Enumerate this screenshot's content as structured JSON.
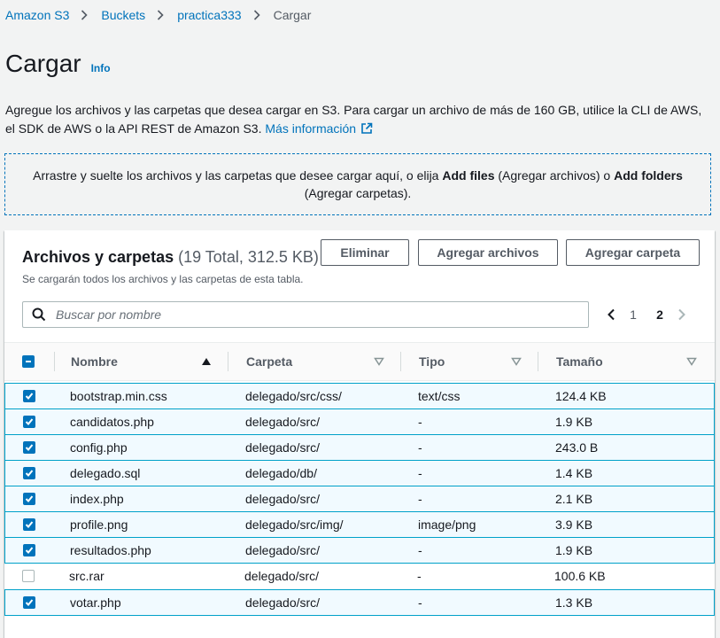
{
  "breadcrumb": [
    {
      "label": "Amazon S3",
      "link": true
    },
    {
      "label": "Buckets",
      "link": true
    },
    {
      "label": "practica333",
      "link": true
    },
    {
      "label": "Cargar",
      "link": false
    }
  ],
  "page": {
    "title": "Cargar",
    "info_label": "Info",
    "description": "Agregue los archivos y las carpetas que desea cargar en S3. Para cargar un archivo de más de 160 GB, utilice la CLI de AWS, el SDK de AWS o la API REST de Amazon S3.",
    "learn_more": "Más información"
  },
  "dropzone": {
    "text_1": "Arrastre y suelte los archivos y las carpetas que desee cargar aquí, o elija",
    "add_files_bold": "Add files",
    "text_2": "(Agregar archivos) o",
    "add_folders_bold": "Add folders",
    "text_3": "(Agregar carpetas)."
  },
  "panel": {
    "title": "Archivos y carpetas",
    "count": "(19 Total, 312.5 KB)",
    "subtitle": "Se cargarán todos los archivos y las carpetas de esta tabla.",
    "delete_label": "Eliminar",
    "add_files_label": "Agregar archivos",
    "add_folder_label": "Agregar carpeta",
    "search_placeholder": "Buscar por nombre",
    "pages": [
      "1",
      "2"
    ],
    "current_page": "2"
  },
  "table": {
    "columns": [
      "Nombre",
      "Carpeta",
      "Tipo",
      "Tamaño"
    ],
    "rows": [
      {
        "name": "bootstrap.min.css",
        "folder": "delegado/src/css/",
        "type": "text/css",
        "size": "124.4 KB",
        "checked": true
      },
      {
        "name": "candidatos.php",
        "folder": "delegado/src/",
        "type": "-",
        "size": "1.9 KB",
        "checked": true
      },
      {
        "name": "config.php",
        "folder": "delegado/src/",
        "type": "-",
        "size": "243.0 B",
        "checked": true
      },
      {
        "name": "delegado.sql",
        "folder": "delegado/db/",
        "type": "-",
        "size": "1.4 KB",
        "checked": true
      },
      {
        "name": "index.php",
        "folder": "delegado/src/",
        "type": "-",
        "size": "2.1 KB",
        "checked": true
      },
      {
        "name": "profile.png",
        "folder": "delegado/src/img/",
        "type": "image/png",
        "size": "3.9 KB",
        "checked": true
      },
      {
        "name": "resultados.php",
        "folder": "delegado/src/",
        "type": "-",
        "size": "1.9 KB",
        "checked": true
      },
      {
        "name": "src.rar",
        "folder": "delegado/src/",
        "type": "-",
        "size": "100.6 KB",
        "checked": false
      },
      {
        "name": "votar.php",
        "folder": "delegado/src/",
        "type": "-",
        "size": "1.3 KB",
        "checked": true
      }
    ]
  },
  "colors": {
    "link": "#0073bb",
    "selected_row_bg": "#f1faff",
    "selected_row_border": "#00a1c9",
    "checkbox": "#0073bb"
  }
}
